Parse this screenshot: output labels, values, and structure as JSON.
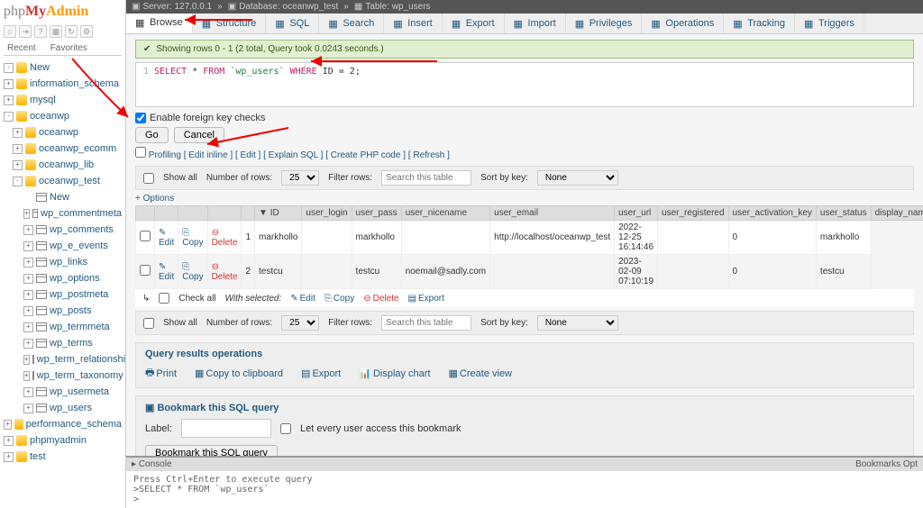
{
  "logo": {
    "p1": "php",
    "p2": "My",
    "p3": "Admin"
  },
  "sidebar_tabs": {
    "recent": "Recent",
    "favorites": "Favorites"
  },
  "tree": [
    {
      "l": 0,
      "exp": "-",
      "ico": "db",
      "label": "New"
    },
    {
      "l": 0,
      "exp": "+",
      "ico": "db",
      "label": "information_schema"
    },
    {
      "l": 0,
      "exp": "+",
      "ico": "db",
      "label": "mysql"
    },
    {
      "l": 0,
      "exp": "-",
      "ico": "db",
      "label": "oceanwp"
    },
    {
      "l": 1,
      "exp": "+",
      "ico": "db",
      "label": "oceanwp"
    },
    {
      "l": 1,
      "exp": "+",
      "ico": "db",
      "label": "oceanwp_ecomm"
    },
    {
      "l": 1,
      "exp": "+",
      "ico": "db",
      "label": "oceanwp_lib"
    },
    {
      "l": 1,
      "exp": "-",
      "ico": "db",
      "label": "oceanwp_test"
    },
    {
      "l": 2,
      "exp": "",
      "ico": "tbl",
      "label": "New"
    },
    {
      "l": 2,
      "exp": "+",
      "ico": "tbl",
      "label": "wp_commentmeta"
    },
    {
      "l": 2,
      "exp": "+",
      "ico": "tbl",
      "label": "wp_comments"
    },
    {
      "l": 2,
      "exp": "+",
      "ico": "tbl",
      "label": "wp_e_events"
    },
    {
      "l": 2,
      "exp": "+",
      "ico": "tbl",
      "label": "wp_links"
    },
    {
      "l": 2,
      "exp": "+",
      "ico": "tbl",
      "label": "wp_options"
    },
    {
      "l": 2,
      "exp": "+",
      "ico": "tbl",
      "label": "wp_postmeta"
    },
    {
      "l": 2,
      "exp": "+",
      "ico": "tbl",
      "label": "wp_posts"
    },
    {
      "l": 2,
      "exp": "+",
      "ico": "tbl",
      "label": "wp_termmeta"
    },
    {
      "l": 2,
      "exp": "+",
      "ico": "tbl",
      "label": "wp_terms"
    },
    {
      "l": 2,
      "exp": "+",
      "ico": "tbl",
      "label": "wp_term_relationships"
    },
    {
      "l": 2,
      "exp": "+",
      "ico": "tbl",
      "label": "wp_term_taxonomy"
    },
    {
      "l": 2,
      "exp": "+",
      "ico": "tbl",
      "label": "wp_usermeta"
    },
    {
      "l": 2,
      "exp": "+",
      "ico": "tbl",
      "label": "wp_users"
    },
    {
      "l": 0,
      "exp": "+",
      "ico": "db",
      "label": "performance_schema"
    },
    {
      "l": 0,
      "exp": "+",
      "ico": "db",
      "label": "phpmyadmin"
    },
    {
      "l": 0,
      "exp": "+",
      "ico": "db",
      "label": "test"
    }
  ],
  "crumb": {
    "server": "Server: 127.0.0.1",
    "db": "Database: oceanwp_test",
    "table": "Table: wp_users"
  },
  "tabs": [
    {
      "label": "Browse",
      "active": true
    },
    {
      "label": "Structure"
    },
    {
      "label": "SQL"
    },
    {
      "label": "Search"
    },
    {
      "label": "Insert"
    },
    {
      "label": "Export"
    },
    {
      "label": "Import"
    },
    {
      "label": "Privileges"
    },
    {
      "label": "Operations"
    },
    {
      "label": "Tracking"
    },
    {
      "label": "Triggers"
    }
  ],
  "success_msg": "Showing rows 0 - 1 (2 total, Query took 0.0243 seconds.)",
  "sql": {
    "line": "1",
    "text_kw1": "SELECT",
    "text_star": " * ",
    "text_kw2": "FROM",
    "text_tbl": " `wp_users` ",
    "text_kw3": "WHERE",
    "text_cond": " ID = 2;"
  },
  "fk_label": "Enable foreign key checks",
  "go_btn": "Go",
  "cancel_btn": "Cancel",
  "link_row": {
    "profiling": "Profiling",
    "edit_inline": "Edit inline",
    "edit": "Edit",
    "explain": "Explain SQL",
    "create_php": "Create PHP code",
    "refresh": "Refresh"
  },
  "bar": {
    "show_all": "Show all",
    "num_rows": "Number of rows:",
    "num_val": "25",
    "filter": "Filter rows:",
    "filter_ph": "Search this table",
    "sort": "Sort by key:",
    "sort_val": "None"
  },
  "options_link": "+ Options",
  "cols": [
    "",
    "",
    "",
    "",
    "",
    "ID",
    "user_login",
    "user_pass",
    "user_nicename",
    "user_email",
    "user_url",
    "user_registered",
    "user_activation_key",
    "user_status",
    "display_name"
  ],
  "rows": [
    {
      "id": "1",
      "login": "markhollo",
      "pass": "",
      "nice": "markhollo",
      "email": "",
      "url": "http://localhost/oceanwp_test",
      "reg": "2022-12-25 16:14:46",
      "key": "",
      "status": "0",
      "display": "markhollo"
    },
    {
      "id": "2",
      "login": "testcu",
      "pass": "",
      "nice": "testcu",
      "email": "noemail@sadly.com",
      "url": "",
      "reg": "2023-02-09 07:10:19",
      "key": "",
      "status": "0",
      "display": "testcu"
    }
  ],
  "row_actions": {
    "edit": "Edit",
    "copy": "Copy",
    "delete": "Delete"
  },
  "checkall": {
    "label": "Check all",
    "with": "With selected:",
    "edit": "Edit",
    "copy": "Copy",
    "delete": "Delete",
    "export": "Export"
  },
  "results_ops": {
    "title": "Query results operations",
    "print": "Print",
    "copy": "Copy to clipboard",
    "export": "Export",
    "chart": "Display chart",
    "view": "Create view"
  },
  "bookmark": {
    "title": "Bookmark this SQL query",
    "label": "Label:",
    "share": "Let every user access this bookmark",
    "btn": "Bookmark this SQL query"
  },
  "console": {
    "title": "Console",
    "links": "Bookmarks   Opt",
    "hint": "Press Ctrl+Enter to execute query",
    "sql": ">SELECT * FROM `wp_users`",
    "prompt": ">"
  }
}
